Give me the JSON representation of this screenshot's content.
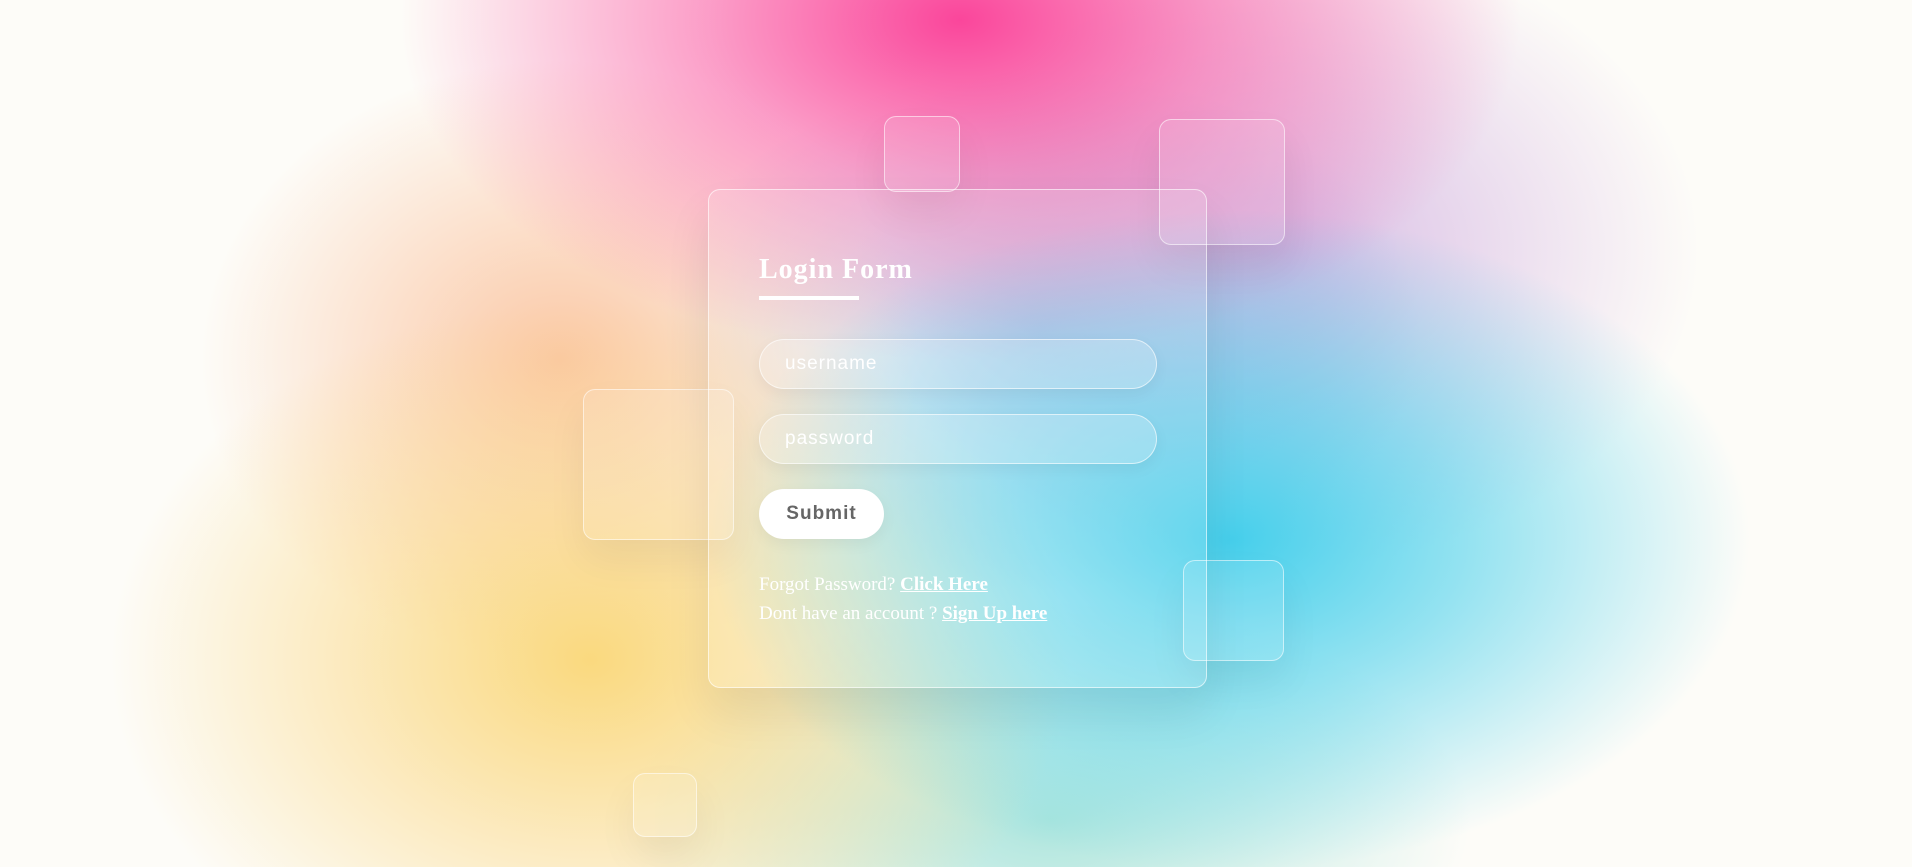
{
  "form": {
    "title": "Login Form",
    "username_placeholder": "username",
    "password_placeholder": "password",
    "submit_label": "Submit",
    "forgot_text": "Forgot Password? ",
    "forgot_link": "Click Here",
    "signup_text": "Dont have an account ? ",
    "signup_link": "Sign Up here"
  }
}
